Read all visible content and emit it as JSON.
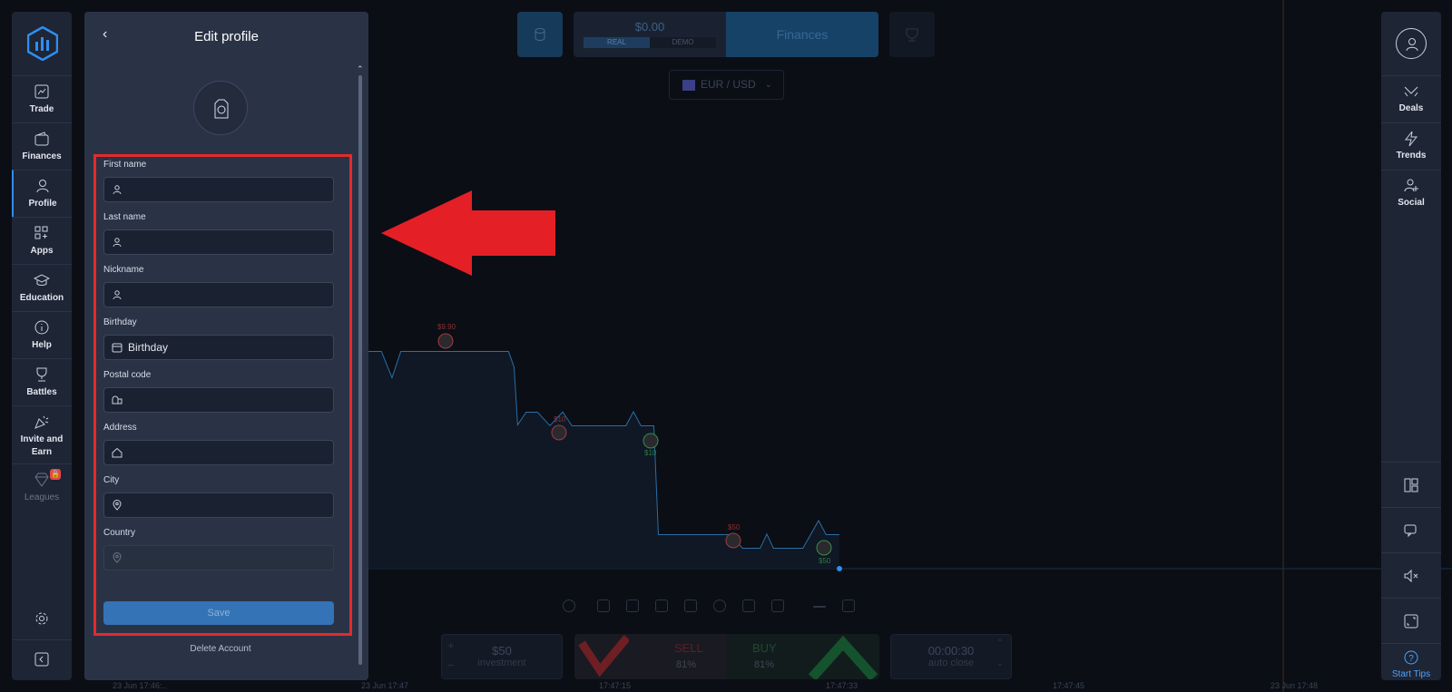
{
  "sidebar": {
    "logo": "chart-logo-icon",
    "items": [
      {
        "label": "Trade",
        "icon": "line-chart-icon"
      },
      {
        "label": "Finances",
        "icon": "wallet-icon"
      },
      {
        "label": "Profile",
        "icon": "user-icon",
        "active": true
      },
      {
        "label": "Apps",
        "icon": "grid-plus-icon"
      },
      {
        "label": "Education",
        "icon": "graduation-cap-icon"
      },
      {
        "label": "Help",
        "icon": "info-icon"
      },
      {
        "label": "Battles",
        "icon": "trophy-icon"
      },
      {
        "label": "Invite and Earn",
        "icon": "party-popper-icon"
      },
      {
        "label": "Leagues",
        "icon": "diamond-icon",
        "locked": true
      }
    ]
  },
  "right_sidebar": {
    "items": [
      {
        "label": "Deals",
        "icon": "deals-icon"
      },
      {
        "label": "Trends",
        "icon": "lightning-icon"
      },
      {
        "label": "Social",
        "icon": "user-plus-icon"
      }
    ],
    "start_tips": "Start Tips"
  },
  "topbar": {
    "balance": "$0.00",
    "account_real": "REAL",
    "account_demo": "DEMO",
    "finances": "Finances",
    "pair": "EUR / USD"
  },
  "trade": {
    "investment_value": "$50",
    "investment_label": "investment",
    "sell_label": "SELL",
    "sell_pct": "81%",
    "buy_label": "BUY",
    "buy_pct": "81%",
    "timer_value": "00:00:30",
    "timer_label": "auto close"
  },
  "chart_marks": {
    "m1": "$9.90",
    "m2": "$10",
    "m3": "$10",
    "m4": "$50",
    "m5": "$50"
  },
  "time_labels": [
    "23 Jun 17:46:..",
    "23 Jun 17:47",
    "17:47:15",
    "17:47:33",
    "17:47:45",
    "23 Jun 17:48"
  ],
  "panel": {
    "title": "Edit profile",
    "fields": [
      {
        "label": "First name",
        "placeholder": "",
        "icon": "user-icon"
      },
      {
        "label": "Last name",
        "placeholder": "",
        "icon": "user-icon"
      },
      {
        "label": "Nickname",
        "placeholder": "",
        "icon": "user-icon"
      },
      {
        "label": "Birthday",
        "placeholder": "Birthday",
        "icon": "calendar-icon"
      },
      {
        "label": "Postal code",
        "placeholder": "",
        "icon": "mailbox-icon"
      },
      {
        "label": "Address",
        "placeholder": "",
        "icon": "home-icon"
      },
      {
        "label": "City",
        "placeholder": "",
        "icon": "map-pin-icon"
      },
      {
        "label": "Country",
        "placeholder": "",
        "icon": "map-pin-icon"
      }
    ],
    "save": "Save",
    "delete": "Delete Account"
  }
}
